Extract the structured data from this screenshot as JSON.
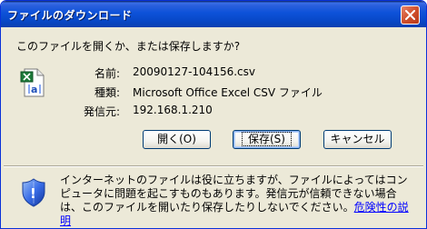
{
  "window": {
    "title": "ファイルのダウンロード"
  },
  "prompt": "このファイルを開くか、または保存しますか?",
  "file": {
    "name_label": "名前:",
    "name_value": "20090127-104156.csv",
    "type_label": "種類:",
    "type_value": "Microsoft Office Excel CSV ファイル",
    "from_label": "発信元:",
    "from_value": "192.168.1.210",
    "icon": "excel-csv-icon"
  },
  "buttons": {
    "open": "開く(O)",
    "save": "保存(S)",
    "cancel": "キャンセル"
  },
  "warning": {
    "text": "インターネットのファイルは役に立ちますが、ファイルによってはコンピュータに問題を起こすものもあります。発信元が信頼できない場合は、このファイルを開いたり保存したりしないでください。",
    "link": "危険性の説明"
  },
  "icons": {
    "close": "close-icon",
    "shield": "security-shield-icon"
  }
}
